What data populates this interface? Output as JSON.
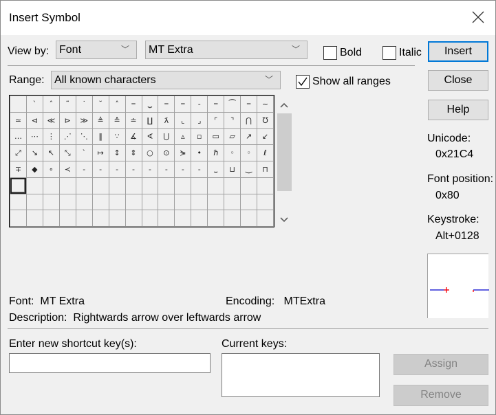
{
  "window": {
    "title": "Insert Symbol",
    "close_icon": "close-icon"
  },
  "view_by": {
    "label": "View by:",
    "value": "Font"
  },
  "font_select": {
    "value": "MT Extra"
  },
  "bold": {
    "label": "Bold",
    "checked": false
  },
  "italic": {
    "label": "Italic",
    "checked": false
  },
  "range": {
    "label": "Range:",
    "value": "All known characters"
  },
  "show_all_ranges": {
    "label": "Show all ranges",
    "checked": true
  },
  "buttons": {
    "insert": "Insert",
    "close": "Close",
    "help": "Help",
    "assign": "Assign",
    "remove": "Remove"
  },
  "info": {
    "unicode_label": "Unicode:",
    "unicode_value": "0x21C4",
    "font_position_label": "Font position:",
    "font_position_value": "0x80",
    "keystroke_label": "Keystroke:",
    "keystroke_value": "Alt+0128"
  },
  "details": {
    "font_label": "Font:",
    "font_value": "MT Extra",
    "encoding_label": "Encoding:",
    "encoding_value": "MTExtra",
    "description_label": "Description:",
    "description_value": "Rightwards arrow over leftwards arrow"
  },
  "shortcut": {
    "new_label": "Enter new shortcut key(s):",
    "new_value": "",
    "current_label": "Current keys:"
  },
  "grid": {
    "rows": [
      [
        "",
        "ˋ",
        "ˆ",
        "˜",
        "˙",
        "˘",
        "˄",
        "⎯",
        "⏟",
        "⎯",
        "⎯",
        "‐",
        "⎯",
        "⏜",
        "⎯",
        "~"
      ],
      [
        "≃",
        "⊲",
        "≪",
        "⊳",
        "≫",
        "≜",
        "≙",
        "≐",
        "∐",
        "ƛ",
        "⌞",
        "⌟",
        "⌜",
        "⌝",
        "⋂",
        "℧"
      ],
      [
        "…",
        "⋯",
        "⋮",
        "⋰",
        "⋱",
        "‖",
        "∵",
        "∡",
        "∢",
        "⋃",
        "▵",
        "▫",
        "▭",
        "▱",
        "↗",
        "↙"
      ],
      [
        "⤢",
        "↘",
        "↖",
        "⤡",
        "ˋ",
        "↦",
        "↕",
        "⇕",
        "○",
        "⊙",
        "⋟",
        "•",
        "ℏ",
        "◦",
        "◦",
        "ℓ"
      ],
      [
        "∓",
        "◆",
        "∘",
        "≺",
        "-",
        "-",
        "-",
        "-",
        "-",
        "-",
        "-",
        "-",
        "⎵",
        "⊔",
        "⏝",
        "⊓"
      ],
      [
        "",
        "",
        "",
        "",
        "",
        "",
        "",
        "",
        "",
        "",
        "",
        "",
        "",
        "",
        "",
        ""
      ],
      [
        "",
        "",
        "",
        "",
        "",
        "",
        "",
        "",
        "",
        "",
        "",
        "",
        "",
        "",
        "",
        ""
      ],
      [
        "",
        "",
        "",
        "",
        "",
        "",
        "",
        "",
        "",
        "",
        "",
        "",
        "",
        "",
        "",
        ""
      ]
    ],
    "selected": {
      "row": 5,
      "col": 0
    }
  },
  "colors": {
    "accent": "#0078d7",
    "preview_line": "#0000cc",
    "preview_marker": "#ff0000"
  }
}
